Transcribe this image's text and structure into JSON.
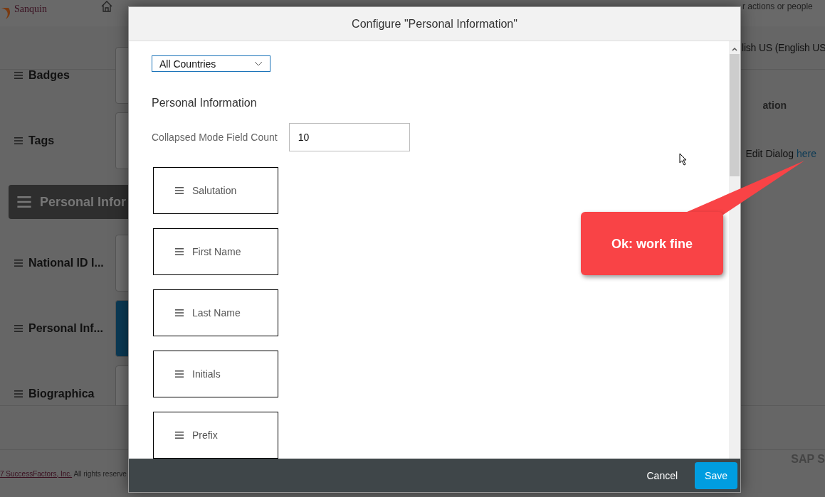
{
  "header": {
    "logo": "Sanquin",
    "search_placeholder": "r actions or people"
  },
  "language": "lish US (English US",
  "sidebar": {
    "items": [
      {
        "label": "Badges",
        "selected": false,
        "active": false
      },
      {
        "label": "Tags",
        "selected": false,
        "active": false
      },
      {
        "label": "Personal Infor",
        "selected": true,
        "active": false
      },
      {
        "label": "National ID I...",
        "selected": false,
        "active": false
      },
      {
        "label": "Personal Inf...",
        "selected": false,
        "active": true
      },
      {
        "label": "Biographica",
        "selected": false,
        "active": false
      }
    ]
  },
  "right_panel": {
    "heading": "ation",
    "text": "Edit Dialog",
    "link": "here"
  },
  "footer": {
    "link": "7 SuccessFactors, Inc.",
    "text": "All rights reserve",
    "brand": "SAP S"
  },
  "dialog": {
    "title": "Configure \"Personal Information\"",
    "country_select": {
      "value": "All Countries"
    },
    "section": "Personal Information",
    "field_count": {
      "label": "Collapsed Mode Field Count",
      "value": "10"
    },
    "fields": [
      "Salutation",
      "First Name",
      "Last Name",
      "Initials",
      "Prefix"
    ],
    "buttons": [
      {
        "label": "Cancel",
        "kind": "secondary"
      },
      {
        "label": "Save",
        "kind": "primary"
      }
    ]
  },
  "annotation": {
    "text": "Ok: work fine"
  }
}
